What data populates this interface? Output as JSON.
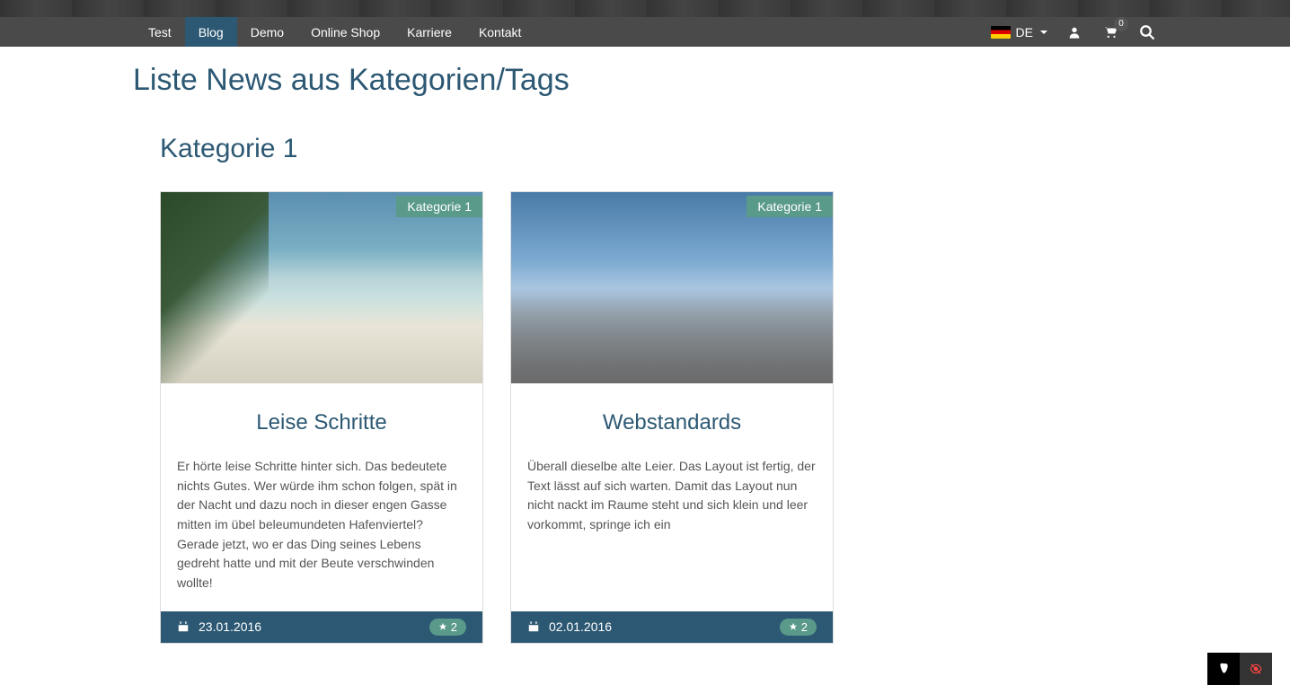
{
  "nav": {
    "items": [
      {
        "label": "Test",
        "active": false
      },
      {
        "label": "Blog",
        "active": true
      },
      {
        "label": "Demo",
        "active": false
      },
      {
        "label": "Online Shop",
        "active": false
      },
      {
        "label": "Karriere",
        "active": false
      },
      {
        "label": "Kontakt",
        "active": false
      }
    ],
    "lang": "DE",
    "cart_count": "0"
  },
  "page": {
    "title": "Liste News aus Kategorien/Tags",
    "category_heading": "Kategorie 1"
  },
  "cards": [
    {
      "badge": "Kategorie 1",
      "title": "Leise Schritte",
      "text": "Er hörte leise Schritte hinter sich. Das bedeutete nichts Gutes. Wer würde ihm schon folgen, spät in der Nacht und dazu noch in dieser engen Gasse mitten im übel beleumundeten Hafenviertel? Gerade jetzt, wo er das Ding seines Lebens gedreht hatte und mit der Beute verschwinden wollte!",
      "date": "23.01.2016",
      "stars": "2"
    },
    {
      "badge": "Kategorie 1",
      "title": "Webstandards",
      "text": "Überall dieselbe alte Leier. Das Layout ist fertig, der Text lässt auf sich warten. Damit das Layout nun nicht nackt im Raume steht und sich klein und leer vorkommt, springe ich ein",
      "date": "02.01.2016",
      "stars": "2"
    }
  ]
}
